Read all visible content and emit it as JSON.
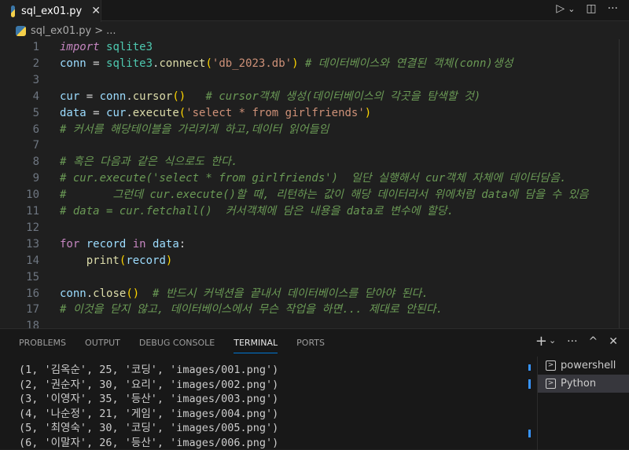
{
  "tab": {
    "filename": "sql_ex01.py",
    "close": "✕"
  },
  "actions": {
    "run": "▷",
    "run_menu": "⌄",
    "split": "◫",
    "more": "···"
  },
  "breadcrumb": {
    "file": "sql_ex01.py",
    "sep": ">",
    "rest": "..."
  },
  "code": [
    [
      [
        "kw",
        "import"
      ],
      [
        "op",
        " "
      ],
      [
        "mod",
        "sqlite3"
      ]
    ],
    [
      [
        "var",
        "conn"
      ],
      [
        "op",
        " = "
      ],
      [
        "mod",
        "sqlite3"
      ],
      [
        "op",
        "."
      ],
      [
        "fn",
        "connect"
      ],
      [
        "par",
        "("
      ],
      [
        "str",
        "'db_2023.db'"
      ],
      [
        "par",
        ")"
      ],
      [
        "op",
        " "
      ],
      [
        "cm",
        "# 데이터베이스와 연결된 객체(conn)생성"
      ]
    ],
    [],
    [
      [
        "var",
        "cur"
      ],
      [
        "op",
        " = "
      ],
      [
        "var",
        "conn"
      ],
      [
        "op",
        "."
      ],
      [
        "fn",
        "cursor"
      ],
      [
        "par",
        "()"
      ],
      [
        "op",
        "   "
      ],
      [
        "cm",
        "# cursor객체 생성(데이터베이스의 각곳을 탐색할 것)"
      ]
    ],
    [
      [
        "var",
        "data"
      ],
      [
        "op",
        " = "
      ],
      [
        "var",
        "cur"
      ],
      [
        "op",
        "."
      ],
      [
        "fn",
        "execute"
      ],
      [
        "par",
        "("
      ],
      [
        "str",
        "'select * from girlfriends'"
      ],
      [
        "par",
        ")"
      ]
    ],
    [
      [
        "cm",
        "# 커서를 해당테이블을 가리키게 하고,데이터 읽어들임"
      ]
    ],
    [],
    [
      [
        "cm",
        "# 혹은 다음과 같은 식으로도 한다."
      ]
    ],
    [
      [
        "cm",
        "# cur.execute('select * from girlfriends')  일단 실행해서 cur객체 자체에 데이터담음."
      ]
    ],
    [
      [
        "cm",
        "#       그런데 cur.execute()할 때, 리턴하는 값이 해당 데이터라서 위에처럼 data에 담을 수 있음"
      ]
    ],
    [
      [
        "cm",
        "# data = cur.fetchall()  커서객체에 담은 내용을 data로 변수에 할당."
      ]
    ],
    [],
    [
      [
        "kw",
        "for"
      ],
      [
        "op",
        " "
      ],
      [
        "var",
        "record"
      ],
      [
        "op",
        " "
      ],
      [
        "kw",
        "in"
      ],
      [
        "op",
        " "
      ],
      [
        "var",
        "data"
      ],
      [
        "op",
        ":"
      ]
    ],
    [
      [
        "op",
        "    "
      ],
      [
        "fn",
        "print"
      ],
      [
        "par",
        "("
      ],
      [
        "var",
        "record"
      ],
      [
        "par",
        ")"
      ]
    ],
    [],
    [
      [
        "var",
        "conn"
      ],
      [
        "op",
        "."
      ],
      [
        "fn",
        "close"
      ],
      [
        "par",
        "()"
      ],
      [
        "op",
        "  "
      ],
      [
        "cm",
        "# 반드시 커넥션을 끝내서 데이터베이스를 닫아야 된다."
      ]
    ],
    [
      [
        "cm",
        "# 이것을 닫지 않고, 데이터베이스에서 무슨 작업을 하면... 제대로 안된다."
      ]
    ],
    []
  ],
  "panel": {
    "tabs": [
      "PROBLEMS",
      "OUTPUT",
      "DEBUG CONSOLE",
      "TERMINAL",
      "PORTS"
    ],
    "active_tab": "TERMINAL",
    "actions": {
      "add": "+",
      "add_menu": "⌄",
      "more": "···",
      "maximize": "^",
      "close": "✕"
    },
    "terminal_output": [
      "(1, '김옥순', 25, '코딩', 'images/001.png')",
      "(2, '권순자', 30, '요리', 'images/002.png')",
      "(3, '이영자', 35, '등산', 'images/003.png')",
      "(4, '나순정', 21, '게임', 'images/004.png')",
      "(5, '최영숙', 30, '코딩', 'images/005.png')",
      "(6, '이말자', 26, '등산', 'images/006.png')"
    ],
    "terminals": [
      "powershell",
      "Python"
    ],
    "selected_terminal": "Python"
  }
}
